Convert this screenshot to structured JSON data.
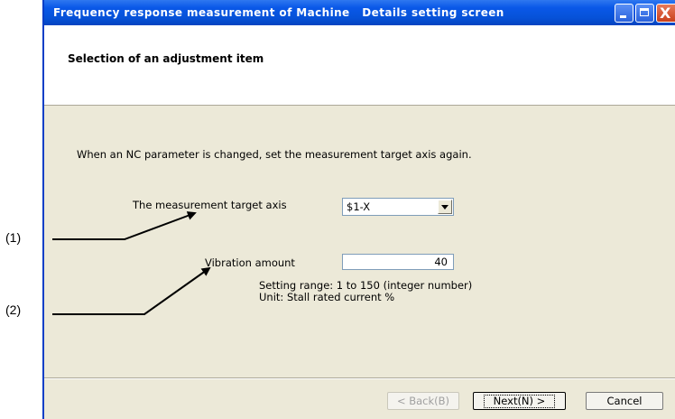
{
  "window": {
    "title": "Frequency response measurement of Machine   Details setting screen",
    "buttons": {
      "minimize": "minimize",
      "maximize": "maximize",
      "close": "X"
    }
  },
  "header": {
    "title": "Selection of an adjustment item"
  },
  "main": {
    "instruction": "When an NC parameter is changed, set the measurement target axis again.",
    "axis_label": "The measurement target axis",
    "axis_value": "$1-X",
    "vibration_label": "Vibration amount",
    "vibration_value": "40",
    "range_text": "Setting range: 1 to 150 (integer number)",
    "unit_text": "Unit: Stall rated current %"
  },
  "footer": {
    "back_label": "< Back(B)",
    "next_label": "Next(N) >",
    "cancel_label": "Cancel"
  },
  "callouts": {
    "c1": "(1)",
    "c2": "(2)"
  }
}
